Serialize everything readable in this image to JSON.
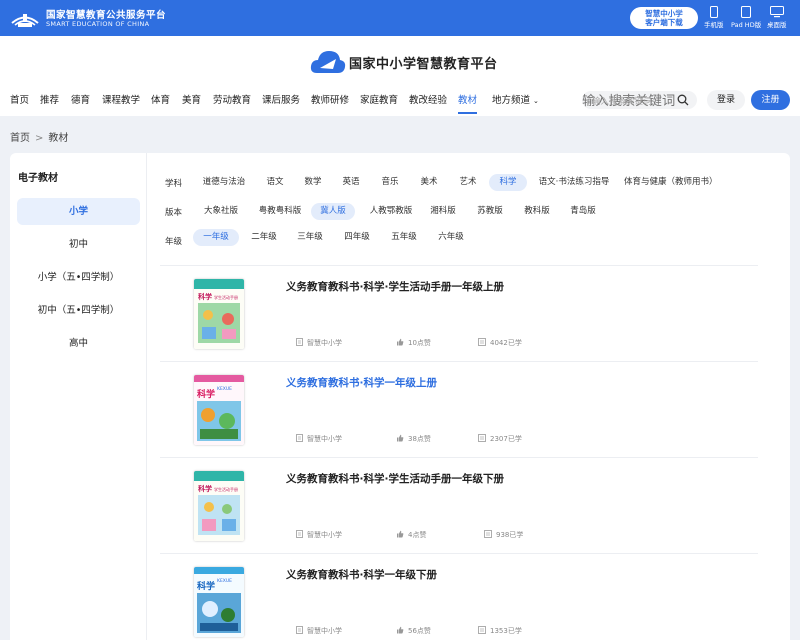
{
  "topbar": {
    "title": "国家智慧教育公共服务平台",
    "subtitle": "SMART EDUCATION OF CHINA",
    "download_line1": "智慧中小学",
    "download_line2": "客户端下载",
    "devices": [
      "手机版",
      "Pad HD版",
      "桌面版"
    ]
  },
  "header": {
    "brand": "国家中小学智慧教育平台",
    "nav": [
      "首页",
      "推荐",
      "德育",
      "课程教学",
      "体育",
      "美育",
      "劳动教育",
      "课后服务",
      "教师研修",
      "家庭教育",
      "教改经验",
      "教材",
      "地方频道"
    ],
    "nav_active": "教材",
    "search_placeholder": "输入搜索关键词",
    "login": "登录",
    "register": "注册"
  },
  "breadcrumb": [
    "首页",
    "教材"
  ],
  "sidebar": {
    "title": "电子教材",
    "items": [
      "小学",
      "初中",
      "小学（五•四学制）",
      "初中（五•四学制）",
      "高中"
    ],
    "active": "小学"
  },
  "filters": {
    "subject": {
      "label": "学科",
      "options": [
        "道德与法治",
        "语文",
        "数学",
        "英语",
        "音乐",
        "美术",
        "艺术",
        "科学",
        "语文·书法练习指导",
        "体育与健康（教师用书）"
      ],
      "active": "科学"
    },
    "edition": {
      "label": "版本",
      "options": [
        "大象社版",
        "粤教粤科版",
        "冀人版",
        "人教鄂教版",
        "湘科版",
        "苏教版",
        "教科版",
        "青岛版"
      ],
      "active": "冀人版"
    },
    "grade": {
      "label": "年级",
      "options": [
        "一年级",
        "二年级",
        "三年级",
        "四年级",
        "五年级",
        "六年级"
      ],
      "active": "一年级"
    }
  },
  "books": [
    {
      "title": "义务教育教科书·科学·学生活动手册一年级上册",
      "publisher": "智慧中小学",
      "likes": "10点赞",
      "learners": "4042已学",
      "highlight": false,
      "cover_text": "科学",
      "cover_sub": "学生活动手册",
      "cover_color": "#2fb5a8"
    },
    {
      "title": "义务教育教科书·科学一年级上册",
      "publisher": "智慧中小学",
      "likes": "38点赞",
      "learners": "2307已学",
      "highlight": true,
      "cover_text": "科学",
      "cover_sub": "KEXUE",
      "cover_color": "#e45aa0"
    },
    {
      "title": "义务教育教科书·科学·学生活动手册一年级下册",
      "publisher": "智慧中小学",
      "likes": "4点赞",
      "learners": "938已学",
      "highlight": false,
      "cover_text": "科学",
      "cover_sub": "学生活动手册",
      "cover_color": "#2fb5a8"
    },
    {
      "title": "义务教育教科书·科学一年级下册",
      "publisher": "智慧中小学",
      "likes": "56点赞",
      "learners": "1353已学",
      "highlight": false,
      "cover_text": "科学",
      "cover_sub": "KEXUE",
      "cover_color": "#3aa9e0"
    }
  ],
  "colors": {
    "primary": "#2f6fe0",
    "active_chip_bg": "#e3ecfb"
  }
}
